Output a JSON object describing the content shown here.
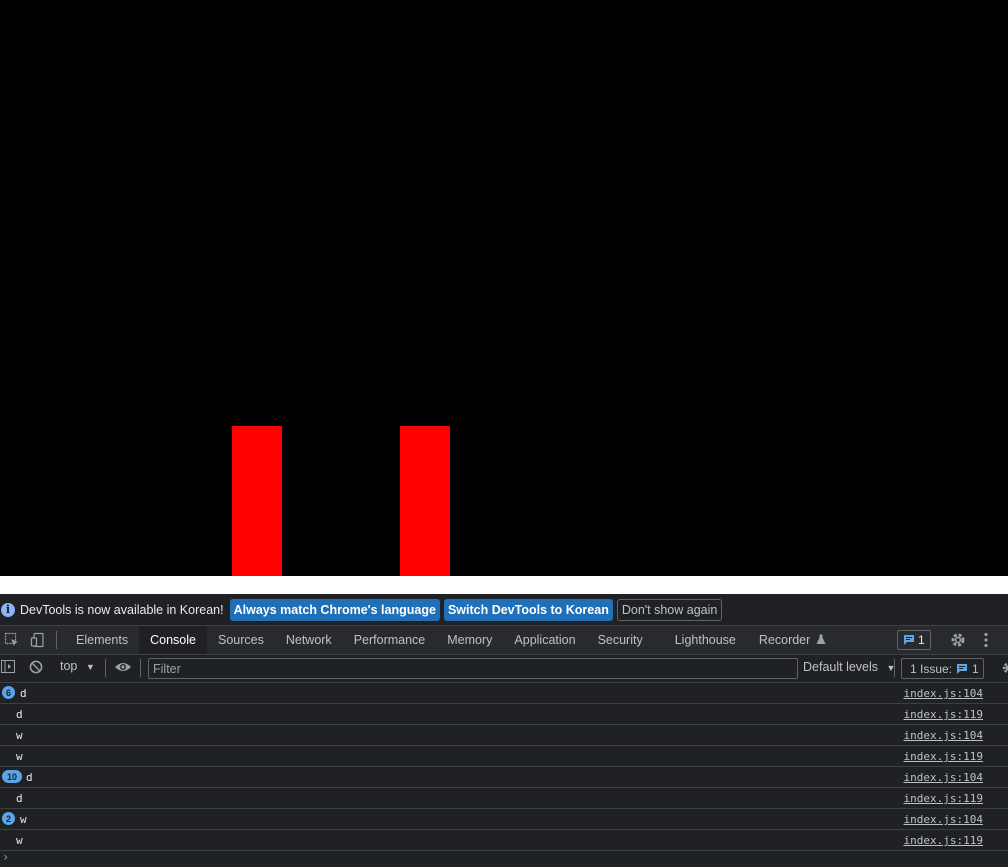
{
  "page": {
    "bg_color": "#000000",
    "block_color": "#ff0000"
  },
  "infobar": {
    "message": "DevTools is now available in Korean!",
    "btn_match": "Always match Chrome's language",
    "btn_switch": "Switch DevTools to Korean",
    "btn_dismiss": "Don't show again"
  },
  "tabs": [
    {
      "label": "Elements"
    },
    {
      "label": "Console"
    },
    {
      "label": "Sources"
    },
    {
      "label": "Network"
    },
    {
      "label": "Performance"
    },
    {
      "label": "Memory"
    },
    {
      "label": "Application"
    },
    {
      "label": "Security"
    },
    {
      "label": "Lighthouse"
    },
    {
      "label": "Recorder"
    }
  ],
  "active_tab": "Console",
  "issues_count": "1",
  "toolbar": {
    "context": "top",
    "filter_placeholder": "Filter",
    "levels": "Default levels",
    "issue_label": "1 Issue:",
    "issue_count": "1"
  },
  "messages": [
    {
      "count": "6",
      "text": "d",
      "source": "index.js:104"
    },
    {
      "count": "",
      "text": "d",
      "source": "index.js:119"
    },
    {
      "count": "",
      "text": "w",
      "source": "index.js:104"
    },
    {
      "count": "",
      "text": "w",
      "source": "index.js:119"
    },
    {
      "count": "10",
      "text": "d",
      "source": "index.js:104"
    },
    {
      "count": "",
      "text": "d",
      "source": "index.js:119"
    },
    {
      "count": "2",
      "text": "w",
      "source": "index.js:104"
    },
    {
      "count": "",
      "text": "w",
      "source": "index.js:119"
    }
  ],
  "prompt": "›"
}
